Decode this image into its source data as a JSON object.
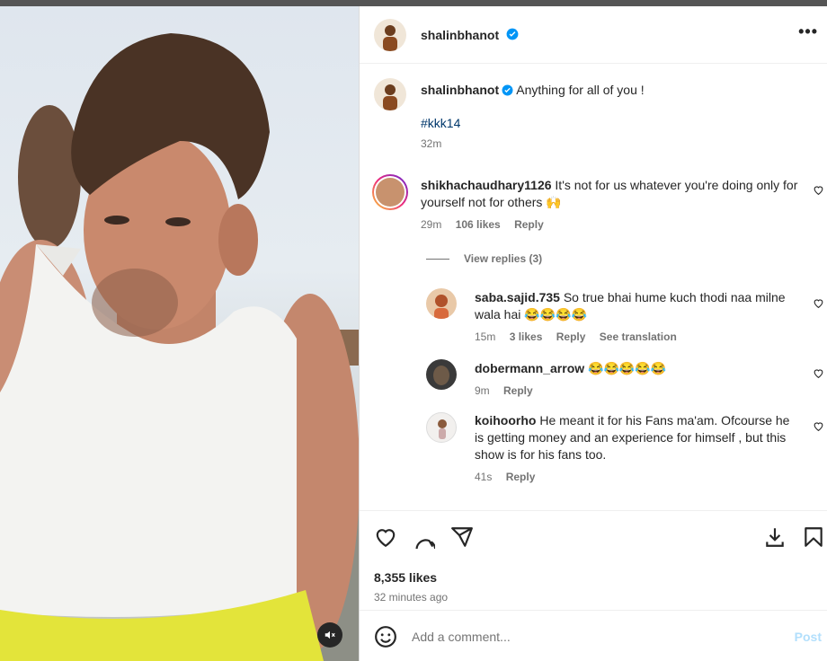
{
  "post": {
    "author": "shalinbhanot",
    "caption": "Anything for all of you !",
    "hashtag": "#kkk14",
    "time": "32m"
  },
  "comments": [
    {
      "user": "shikhachaudhary1126",
      "text": "It's not for us whatever you're doing only for yourself not for others 🙌",
      "time": "29m",
      "likes": "106 likes",
      "reply": "Reply"
    },
    {
      "user": "saba.sajid.735",
      "text": "So true bhai hume kuch thodi naa milne wala hai 😂😂😂😂",
      "time": "15m",
      "likes": "3 likes",
      "reply": "Reply",
      "translate": "See translation"
    },
    {
      "user": "dobermann_arrow",
      "text": "😂😂😂😂😂",
      "time": "9m",
      "reply": "Reply"
    },
    {
      "user": "koihoorho",
      "text": "He meant it for his Fans ma'am. Ofcourse he is getting money and an experience for himself , but this show is for his fans too.",
      "time": "41s",
      "reply": "Reply"
    }
  ],
  "view_replies": "View replies (3)",
  "stats": {
    "likes": "8,355 likes",
    "posted": "32 minutes ago"
  },
  "add_comment": {
    "placeholder": "Add a comment...",
    "post_label": "Post"
  },
  "colors": {
    "verified": "#0095f6",
    "link": "#00376b",
    "muted": "#737373"
  }
}
